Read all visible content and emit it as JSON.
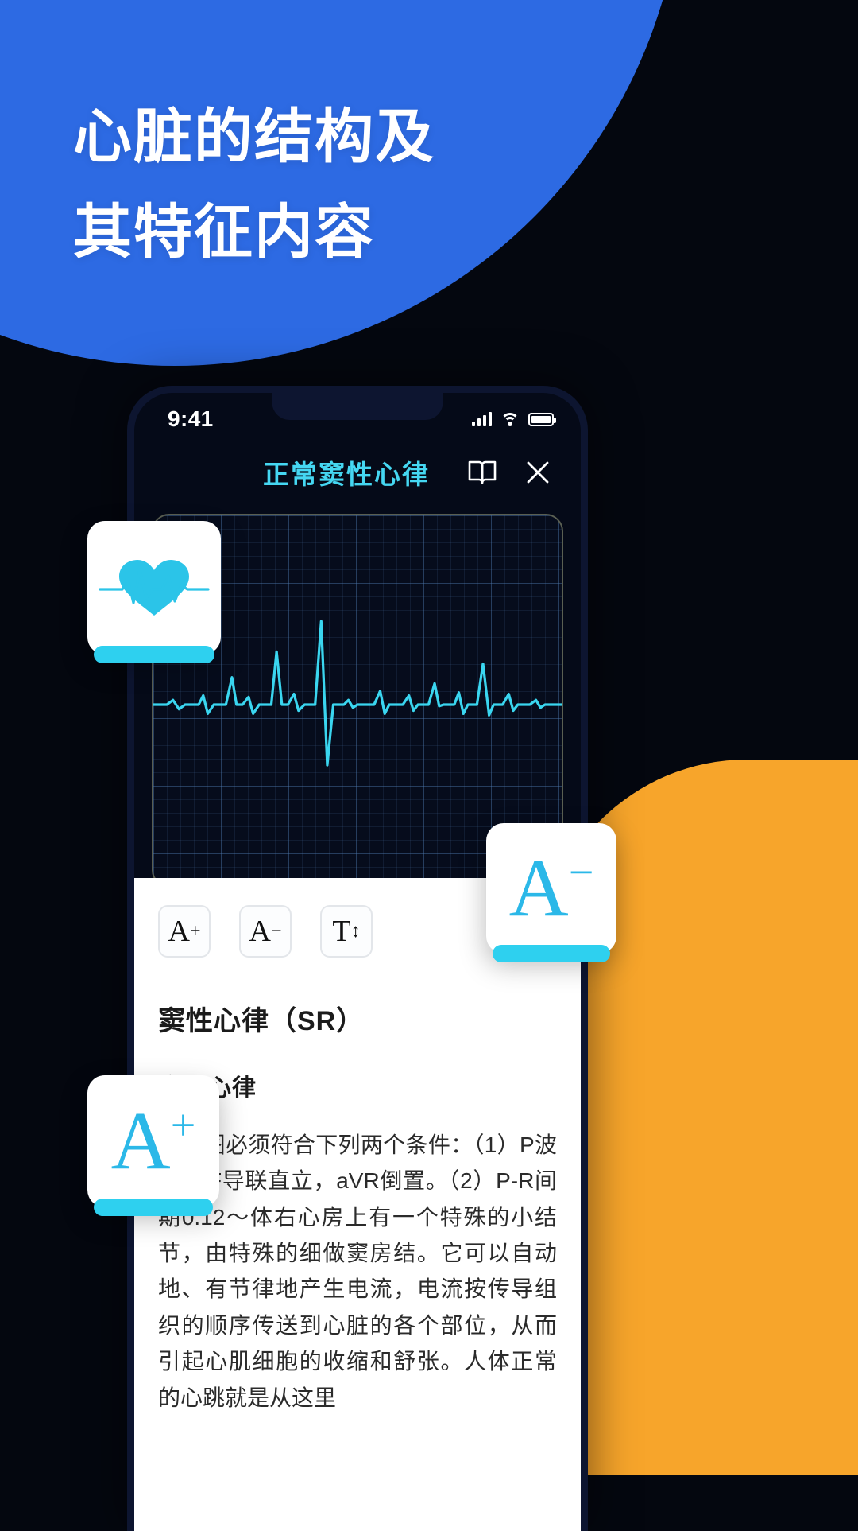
{
  "colors": {
    "hero_blue": "#2d6ae3",
    "accent_cyan": "#2ed0ef",
    "title_cyan": "#45d7f2",
    "orange": "#f7a52b",
    "sheet_bg": "#ffffff",
    "page_bg": "#04070f"
  },
  "hero": {
    "line1": "心脏的结构及",
    "line2": "其特征内容"
  },
  "phone": {
    "status": {
      "time": "9:41",
      "signal_icon": "cellular-signal-icon",
      "wifi_icon": "wifi-icon",
      "battery_icon": "battery-full-icon"
    },
    "header": {
      "title": "正常窦性心律",
      "book_icon": "book-icon",
      "close_icon": "close-icon"
    },
    "ecg_card": {
      "name": "ecg-waveform-card",
      "waveform_color": "#3ad6f0",
      "grid": "ecg-graph-paper"
    },
    "sheet": {
      "tools": [
        {
          "name": "font-increase-button",
          "glyph": "A",
          "sup": "+"
        },
        {
          "name": "font-decrease-button",
          "glyph": "A",
          "sup": "−"
        },
        {
          "name": "line-spacing-button",
          "glyph": "T",
          "sup": "↕"
        }
      ],
      "heading_1": "窦性心律（SR）",
      "heading_2": "窦性心律",
      "body": "心电图必须符合下列两个条件：（1）P波在aVF导联直立，aVR倒置。（2）P-R间期0.12～体右心房上有一个特殊的小结节，由特殊的细做窦房结。它可以自动地、有节律地产生电流，电流按传导组织的顺序传送到心脏的各个部位，从而引起心肌细胞的收缩和舒张。人体正常的心跳就是从这里"
    }
  },
  "float_cards": [
    {
      "name": "heart-ecg-card",
      "icon": "heart-pulse-icon"
    },
    {
      "name": "font-decrease-card",
      "glyph": "A",
      "sup": "−"
    },
    {
      "name": "font-increase-card",
      "glyph": "A",
      "sup": "+"
    }
  ]
}
